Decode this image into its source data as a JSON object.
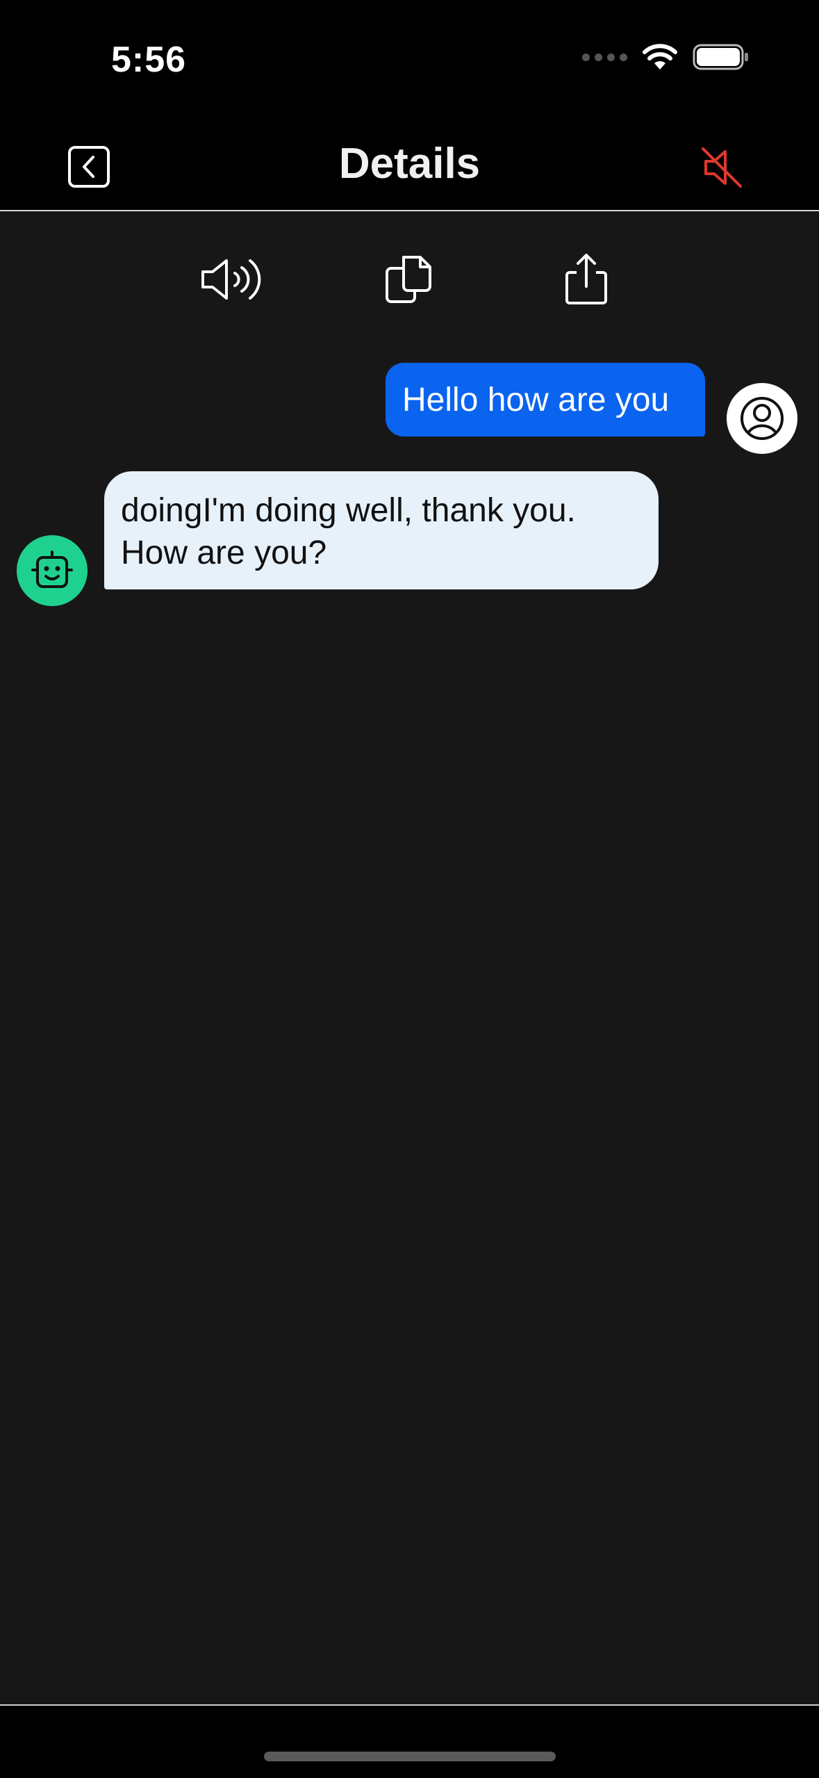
{
  "status_bar": {
    "time": "5:56",
    "icons": [
      "cellular-signal-icon",
      "wifi-icon",
      "battery-icon"
    ]
  },
  "nav": {
    "title": "Details",
    "back_icon": "chevron-left-square-icon",
    "mute_icon": "speaker-muted-icon",
    "mute_color": "#e0382d"
  },
  "toolbar": {
    "items": [
      {
        "name": "speak-button",
        "icon": "speaker-wave-icon"
      },
      {
        "name": "copy-button",
        "icon": "copy-icon"
      },
      {
        "name": "share-button",
        "icon": "share-icon"
      }
    ]
  },
  "messages": [
    {
      "sender": "user",
      "text": "Hello how are you",
      "bubble_color": "#0a64ef",
      "avatar_icon": "user-circle-icon"
    },
    {
      "sender": "bot",
      "text": " doingI'm doing well, thank you. How are you?",
      "bubble_color": "#e7f1fa",
      "avatar_icon": "robot-face-icon",
      "avatar_color": "#1fd18f"
    }
  ],
  "colors": {
    "background": "#181718",
    "bars": "#000000",
    "accent_blue": "#0a64ef"
  }
}
